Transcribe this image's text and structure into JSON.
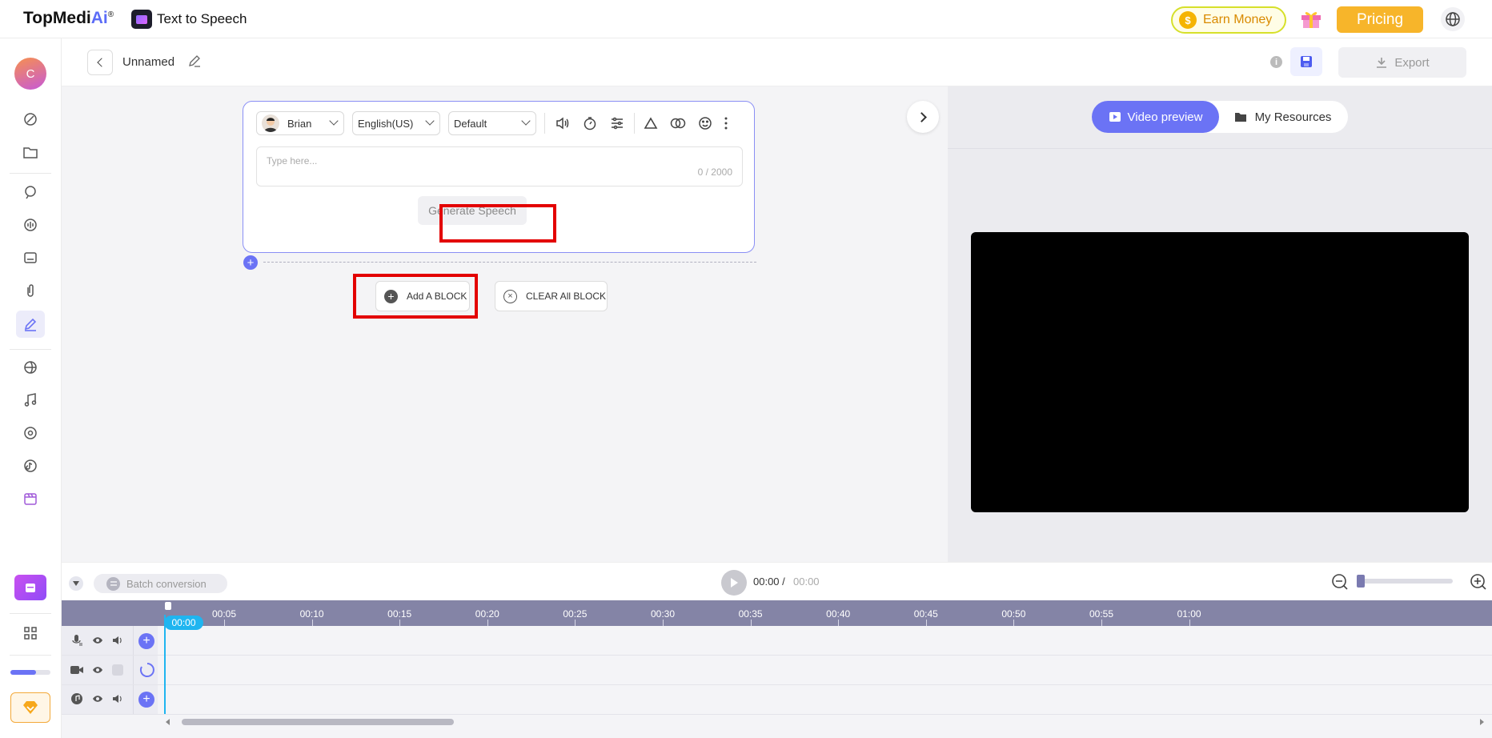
{
  "app": {
    "logo_text": "TopMedi",
    "logo_ai": "Ai",
    "logo_reg": "®",
    "product_title": "Text to Speech"
  },
  "topbar": {
    "earn_money": "Earn Money",
    "pricing": "Pricing"
  },
  "project": {
    "name": "Unnamed",
    "export": "Export"
  },
  "block": {
    "voice": "Brian",
    "language": "English(US)",
    "style": "Default",
    "textarea_placeholder": "Type here...",
    "char_count": "0 / 2000",
    "generate": "Generate Speech"
  },
  "actions": {
    "add_block": "Add A BLOCK",
    "clear_block": "CLEAR All BLOCK"
  },
  "preview_tabs": {
    "video": "Video preview",
    "resources": "My Resources"
  },
  "timeline": {
    "batch": "Batch conversion",
    "current_time": "00:00 /",
    "total_time": "00:00",
    "playhead": "00:00",
    "ticks": [
      "00:05",
      "00:10",
      "00:15",
      "00:20",
      "00:25",
      "00:30",
      "00:35",
      "00:40",
      "00:45",
      "00:50",
      "00:55",
      "01:00"
    ]
  },
  "user": {
    "avatar_letter": "C"
  },
  "colors": {
    "accent": "#6b73f5",
    "pricing": "#f7b52a",
    "earn_border": "#d6e02a",
    "playhead": "#1fb5f0",
    "highlight": "#e30000"
  }
}
